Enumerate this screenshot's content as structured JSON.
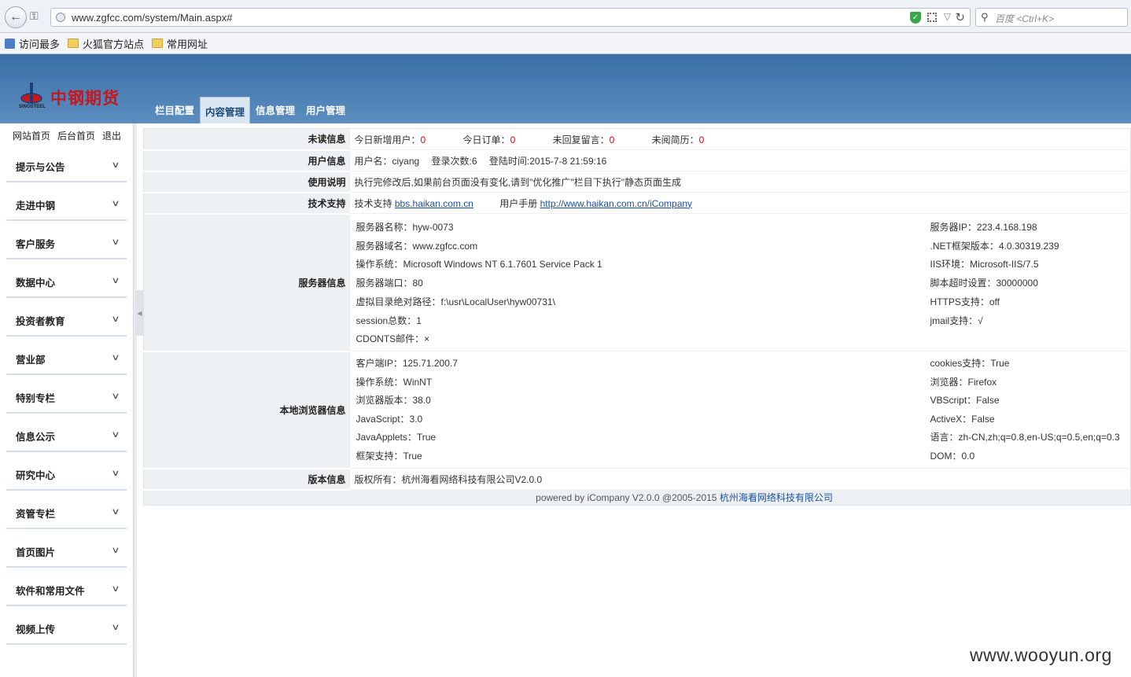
{
  "browser": {
    "url": "www.zgfcc.com/system/Main.aspx#",
    "search_placeholder": "百度 <Ctrl+K>",
    "bookmarks": [
      "访问最多",
      "火狐官方站点",
      "常用网址"
    ]
  },
  "header": {
    "logo_text": "中钢期货",
    "logo_sub": "SINOSTEEL",
    "nav": [
      "栏目配置",
      "内容管理",
      "信息管理",
      "用户管理"
    ],
    "active_nav": "内容管理"
  },
  "sidebar": {
    "top_links": [
      "网站首页",
      "后台首页",
      "退出"
    ],
    "items": [
      "提示与公告",
      "走进中钢",
      "客户服务",
      "数据中心",
      "投资者教育",
      "营业部",
      "特别专栏",
      "信息公示",
      "研究中心",
      "资管专栏",
      "首页图片",
      "软件和常用文件",
      "视频上传"
    ]
  },
  "info": {
    "unread": {
      "label": "未读信息",
      "new_users": "今日新增用户：",
      "new_users_val": "0",
      "orders": "今日订单：",
      "orders_val": "0",
      "replies": "未回复留言：",
      "replies_val": "0",
      "resumes": "未阅简历：",
      "resumes_val": "0"
    },
    "user": {
      "label": "用户信息",
      "username": "用户名：ciyang",
      "logins": "登录次数:6",
      "login_time": "登陆时间:2015-7-8 21:59:16"
    },
    "usage": {
      "label": "使用说明",
      "text": "执行完修改后,如果前台页面没有变化,请到\"优化推广\"栏目下执行\"静态页面生成"
    },
    "support": {
      "label": "技术支持",
      "support_text": "技术支持",
      "support_link": "bbs.haikan.com.cn",
      "manual_text": "用户手册",
      "manual_link": "http://www.haikan.com.cn/iCompany"
    },
    "server": {
      "label": "服务器信息",
      "left": [
        "服务器名称：hyw-0073",
        "服务器域名：www.zgfcc.com",
        "操作系统：Microsoft Windows NT 6.1.7601 Service Pack 1",
        "服务器端口：80",
        "虚拟目录绝对路径：f:\\usr\\LocalUser\\hyw00731\\",
        "session总数：1",
        "CDONTS邮件：×"
      ],
      "right": [
        "服务器IP：223.4.168.198",
        ".NET框架版本：4.0.30319.239",
        "IIS环境：Microsoft-IIS/7.5",
        "脚本超时设置：30000000",
        "HTTPS支持：off",
        "jmail支持：√"
      ]
    },
    "browser_info": {
      "label": "本地浏览器信息",
      "left": [
        "客户端IP：125.71.200.7",
        "操作系统：WinNT",
        "浏览器版本：38.0",
        "JavaScript：3.0",
        "JavaApplets：True",
        "框架支持：True"
      ],
      "right": [
        "cookies支持：True",
        "浏览器：Firefox",
        "VBScript：False",
        "ActiveX：False",
        "语言：zh-CN,zh;q=0.8,en-US;q=0.5,en;q=0.3",
        "DOM：0.0"
      ]
    },
    "version": {
      "label": "版本信息",
      "text": "版权所有：杭州海看网络科技有限公司V2.0.0"
    },
    "footer": {
      "text": "powered by iCompany V2.0.0 @2005-2015 ",
      "link": "杭州海看网络科技有限公司"
    }
  },
  "watermark": "www.wooyun.org"
}
